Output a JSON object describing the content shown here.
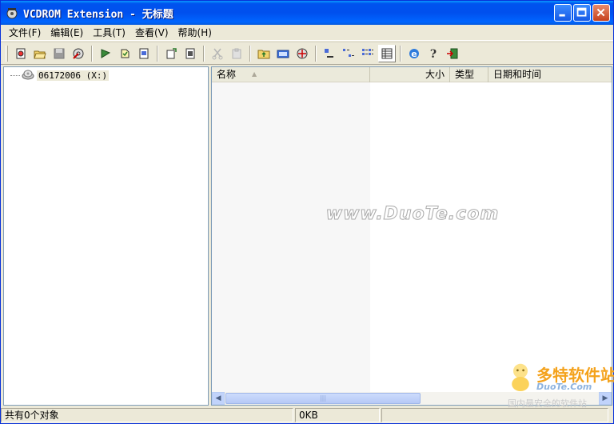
{
  "window": {
    "title": "VCDROM Extension - 无标题"
  },
  "menu": [
    {
      "label": "文件(F)"
    },
    {
      "label": "编辑(E)"
    },
    {
      "label": "工具(T)"
    },
    {
      "label": "查看(V)"
    },
    {
      "label": "帮助(H)"
    }
  ],
  "toolbar_icons": [
    "new-icon",
    "open-icon",
    "save-icon",
    "burn-icon",
    "tool-a-icon",
    "tool-b-icon",
    "tool-c-icon",
    "tool-d-icon",
    "tool-e-icon",
    "cut-icon",
    "paste-icon",
    "folder-up-icon",
    "drive-icon",
    "properties-icon",
    "large-icons-icon",
    "small-icons-icon",
    "list-icon",
    "details-icon",
    "ie-icon",
    "help-icon",
    "exit-icon"
  ],
  "tree": {
    "drive_label": "06172006 (X:)"
  },
  "list": {
    "columns": [
      {
        "label": "名称"
      },
      {
        "label": "大小"
      },
      {
        "label": "类型"
      },
      {
        "label": "日期和时间"
      }
    ],
    "sort_indicator": "▲"
  },
  "watermark": "www.DuoTe.com",
  "corner_logo": {
    "main": "多特软件站",
    "sub": "DuoTe.Com",
    "sub2": "国内最安全的软件站"
  },
  "status": {
    "left": "共有0个对象",
    "middle": "0KB"
  }
}
